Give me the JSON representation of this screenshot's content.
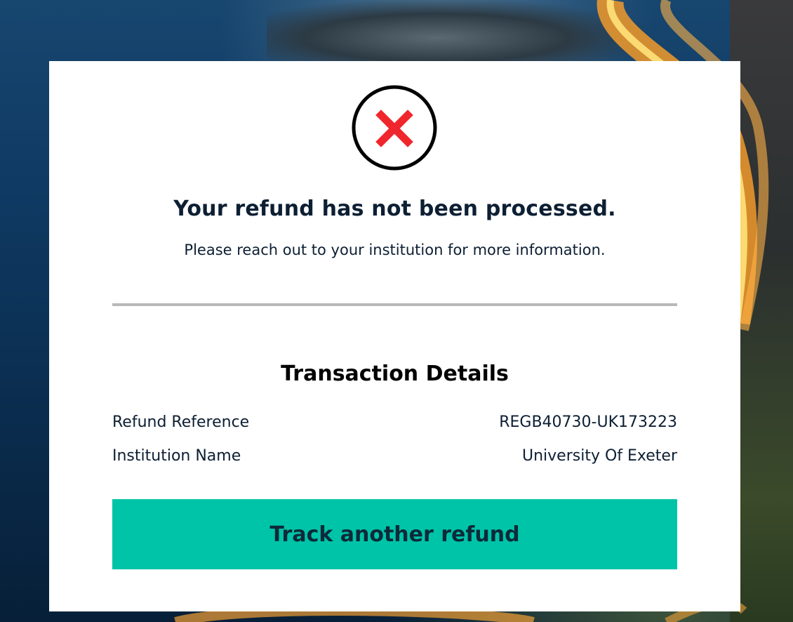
{
  "status": {
    "icon": "error-x-icon",
    "icon_color": "#f0262d",
    "title": "Your refund has not been processed.",
    "message": "Please reach out to your institution for more information."
  },
  "transaction": {
    "heading": "Transaction Details",
    "rows": [
      {
        "label": "Refund Reference",
        "value": "REGB40730-UK173223"
      },
      {
        "label": "Institution Name",
        "value": "University Of Exeter"
      }
    ]
  },
  "actions": {
    "track_label": "Track another refund",
    "track_color": "#00c4a7"
  }
}
